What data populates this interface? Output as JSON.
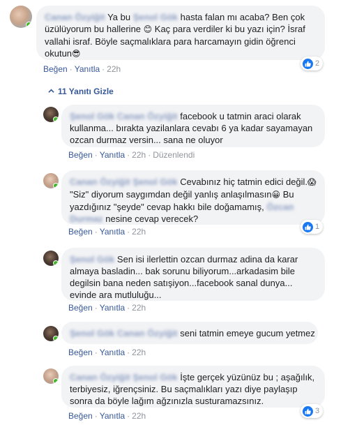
{
  "comments": [
    {
      "author": "Canan Özyiğit",
      "tag": "Şenol Gök",
      "text_a": "Ya bu ",
      "text_b": " hasta falan mı acaba? Ben çok üzülüyorum bu hallerine ",
      "emoji1": "😊",
      "text_c": " Kaç para verdiler ki bu yazı için? İsraf vallahi israf. Böyle saçmalıklara para harcamayın gidin öğrenci okutun",
      "emoji2": "😎",
      "like": "Beğen",
      "reply": "Yanıtla",
      "time": "22h",
      "reaction_count": "2"
    }
  ],
  "replies_toggle": "11 Yanıtı Gizle",
  "replies": [
    {
      "author": "Şenol Gök",
      "tag": "Canan Özyiğit",
      "text": "facebook u tatmin araci olarak kullanma... bırakta yazilanlara cevabı 6 ya kadar sayamayan ozcan durmaz versin... sana ne oluyor",
      "like": "Beğen",
      "reply": "Yanıtla",
      "time": "22h",
      "edited": "Düzenlendi"
    },
    {
      "author": "Canan Özyiğit",
      "tag": "Şenol Gök",
      "text_a": "Cevabınız hiç tatmin edici değil.",
      "emoji1": "😱",
      "text_b": " \"Siz\" diyorum saygımdan değil yanlış anlaşılmasın",
      "emoji2": "😀",
      "text_c": " Bu yazdığınız \"şeyde\" cevap hakkı bile doğamamış, ",
      "tag2": "Özcan Durmaz",
      "text_d": " nesine cevap verecek?",
      "like": "Beğen",
      "reply": "Yanıtla",
      "time": "22h",
      "reaction_count": "1"
    },
    {
      "author": "Şenol Gök",
      "text": "Sen isi ilerlettin ozcan durmaz adina da karar almaya basladin... bak sorunu biliyorum...arkadasim bile degilsin bana neden satışiyon...facebook sanal dunya... evinde ara mutluluğu...",
      "like": "Beğen",
      "reply": "Yanıtla",
      "time": "22h"
    },
    {
      "author": "Şenol Gök",
      "tag": "Canan Özyiğit",
      "text": "seni tatmin emeye gucum yetmez",
      "like": "Beğen",
      "reply": "Yanıtla",
      "time": "22h"
    },
    {
      "author": "Canan Özyiğit",
      "tag": "Şenol Gök",
      "text": "İşte gerçek yüzünüz bu ; aşağılık, terbiyesiz, iğrençsiniz. Bu saçmalıkları yazı diye paylaşıp sonra da böyle lağım ağzınızla susturamazsınız.",
      "like": "Beğen",
      "reply": "Yanıtla",
      "time": "22h",
      "reaction_count": "3"
    }
  ],
  "separator": "·",
  "colors": {
    "link": "#385898",
    "bubble": "#f2f3f5",
    "meta": "#90949c",
    "online": "#42b72a",
    "like_blue": "#1877f2"
  },
  "icons": [
    "like-icon",
    "chevron-up-icon",
    "online-dot-icon"
  ]
}
